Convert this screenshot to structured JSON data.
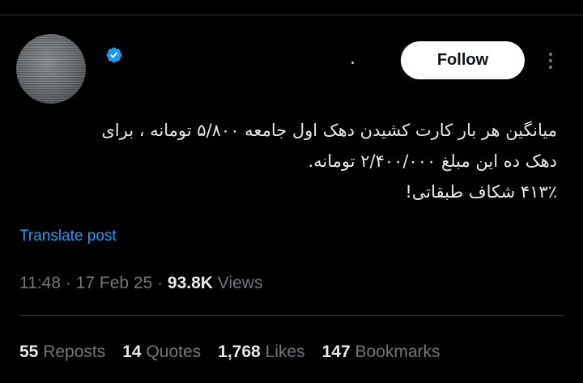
{
  "colors": {
    "background": "#000000",
    "text_primary": "#e7e9ea",
    "text_secondary": "#71767b",
    "link": "#1d9bf0",
    "verified": "#1d9bf0",
    "divider": "#2f3336",
    "follow_bg": "#ffffff"
  },
  "author": {
    "avatar_icon": "avatar-image",
    "verified_icon": "verified-badge-icon"
  },
  "header": {
    "follow_label": "Follow",
    "more_icon": "more-options-icon"
  },
  "tweet": {
    "lines": [
      "میانگین هر بار کارت کشیدن دهک اول جامعه ۵/۸۰۰ تومانه ، برای",
      "دهک ده این مبلغ ۲/۴۰۰/۰۰۰ تومانه.",
      "۴۱۳٪ شکاف طبقاتی!"
    ],
    "translate_label": "Translate post"
  },
  "meta": {
    "time": "11:48",
    "sep1": " · ",
    "date": "17 Feb 25",
    "sep2": " · ",
    "views_count": "93.8K",
    "views_label": " Views"
  },
  "stats": {
    "reposts_count": "55",
    "reposts_label": "Reposts",
    "quotes_count": "14",
    "quotes_label": "Quotes",
    "likes_count": "1,768",
    "likes_label": "Likes",
    "bookmarks_count": "147",
    "bookmarks_label": "Bookmarks"
  }
}
